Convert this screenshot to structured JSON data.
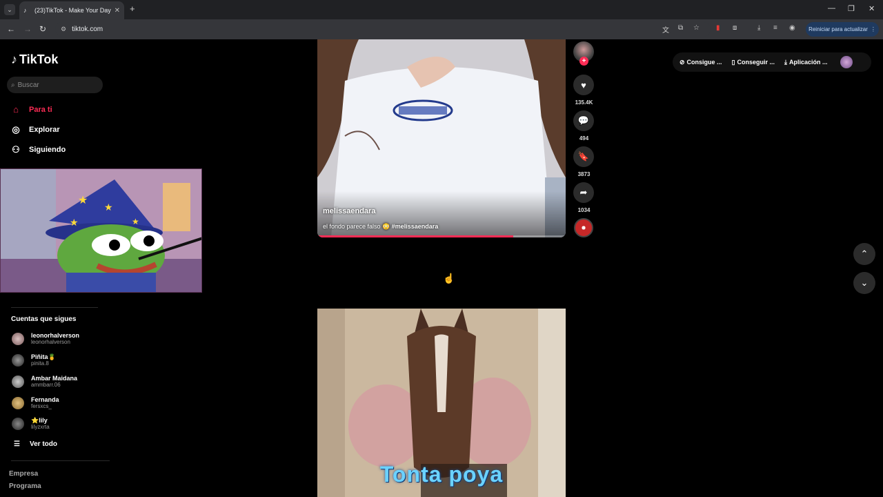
{
  "browser": {
    "tab_title": "(23)TikTok - Make Your Day",
    "url": "tiktok.com",
    "update_button": "Reiniciar para actualizar"
  },
  "sidebar": {
    "logo": "TikTok",
    "search_placeholder": "Buscar",
    "nav": [
      {
        "label": "Para ti",
        "icon": "home-icon",
        "active": true
      },
      {
        "label": "Explorar",
        "icon": "compass-icon"
      },
      {
        "label": "Siguiendo",
        "icon": "user-follow-icon"
      }
    ],
    "following_title": "Cuentas que sigues",
    "following": [
      {
        "name": "leonorhalverson",
        "handle": "leonorhalverson"
      },
      {
        "name": "Piñita🍍",
        "handle": "pinita.8"
      },
      {
        "name": "Ambar Maidana",
        "handle": "ammbarr.06"
      },
      {
        "name": "Fernanda",
        "handle": "fersxcs_"
      },
      {
        "name": "⭐lily",
        "handle": "lilyzxrta"
      }
    ],
    "see_all": "Ver todo",
    "footer_links": [
      "Empresa",
      "Programa"
    ]
  },
  "video1": {
    "author": "melissaendara",
    "caption": "el fondo parece falso 😳 ",
    "hashtag": "#melissaendara",
    "likes": "135.4K",
    "comments": "494",
    "saves": "3873",
    "shares": "1034",
    "progress": 0.79
  },
  "video2": {
    "overlay_text": "Tonta poya"
  },
  "topbar": {
    "get_coins": "Consigue ...",
    "get_app": "Conseguir ...",
    "app": "Aplicación ..."
  },
  "colors": {
    "accent": "#fe2c55",
    "background": "#000000"
  }
}
